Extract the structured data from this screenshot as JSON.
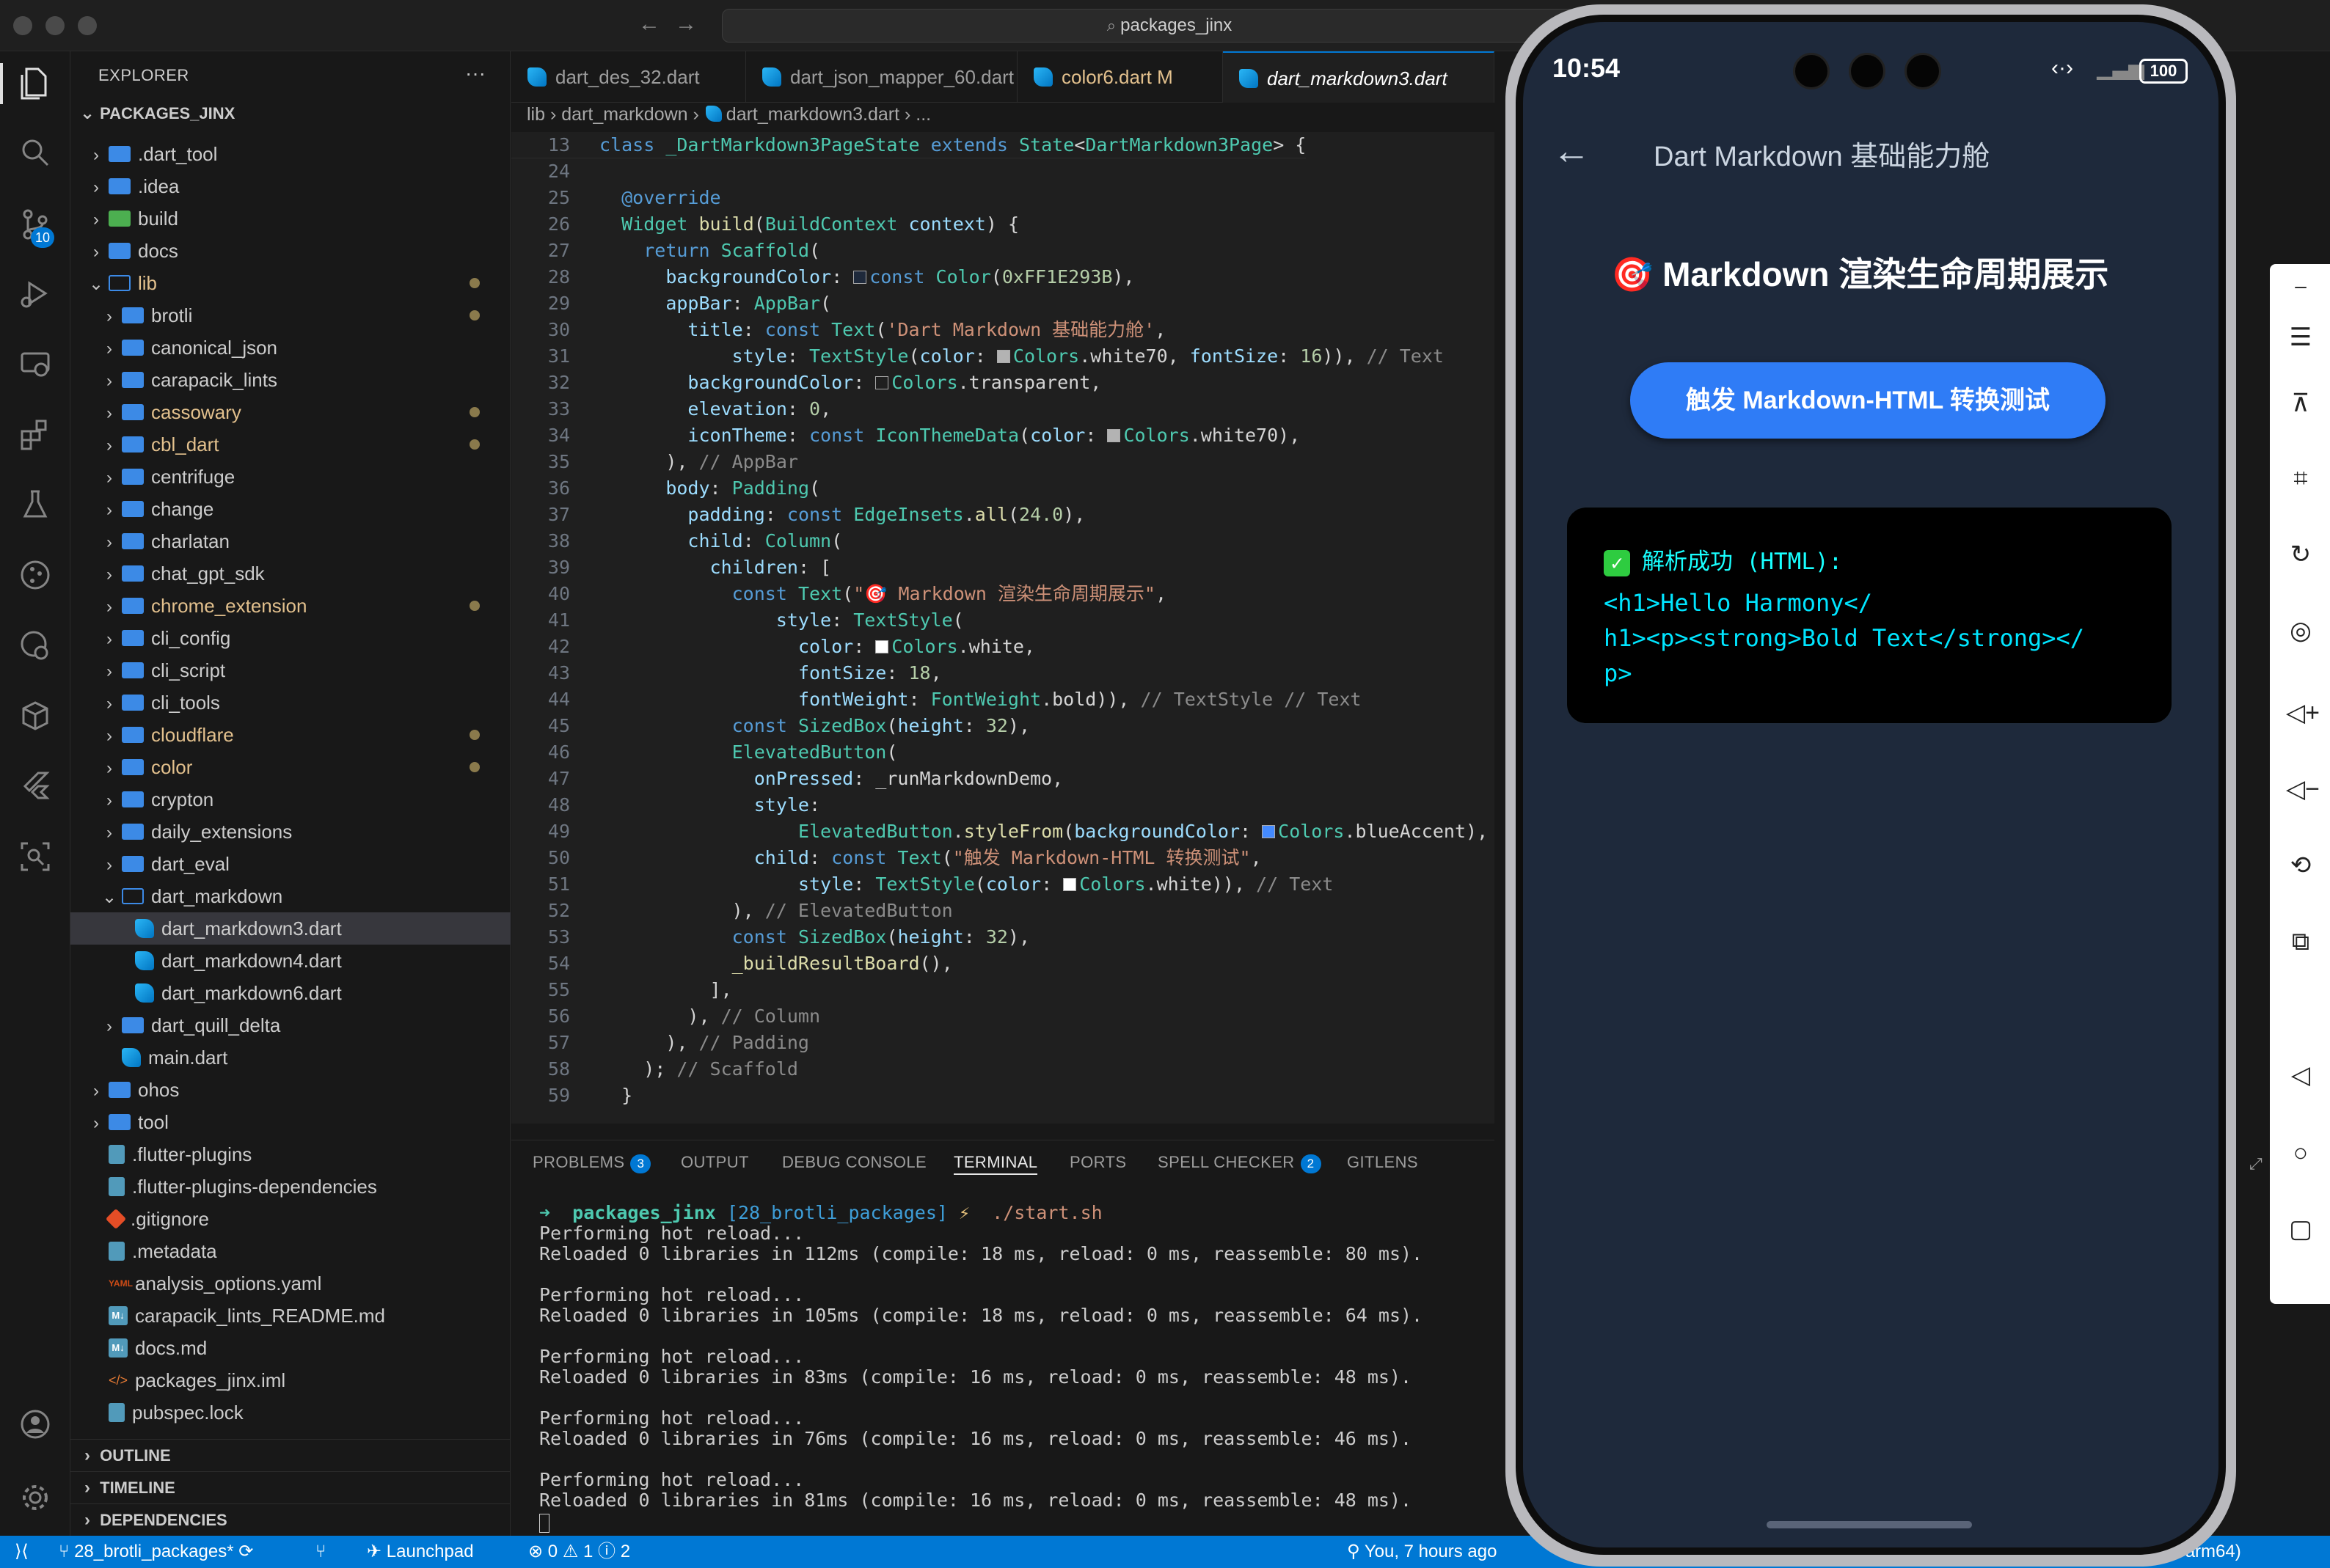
{
  "window": {
    "search": "packages_jinx"
  },
  "activity_bar": {
    "scm_badge": "10"
  },
  "explorer": {
    "title": "EXPLORER",
    "root": "PACKAGES_JINX",
    "items": [
      {
        "label": ".dart_tool",
        "kind": "folder",
        "depth": 1,
        "open": false
      },
      {
        "label": ".idea",
        "kind": "folder",
        "depth": 1,
        "open": false
      },
      {
        "label": "build",
        "kind": "folder-special",
        "depth": 1,
        "open": false
      },
      {
        "label": "docs",
        "kind": "folder",
        "depth": 1,
        "open": false
      },
      {
        "label": "lib",
        "kind": "folder",
        "depth": 1,
        "open": true,
        "color": "yellow",
        "dot": true
      },
      {
        "label": "brotli",
        "kind": "folder",
        "depth": 2,
        "open": false,
        "dot": true
      },
      {
        "label": "canonical_json",
        "kind": "folder",
        "depth": 2,
        "open": false
      },
      {
        "label": "carapacik_lints",
        "kind": "folder",
        "depth": 2,
        "open": false
      },
      {
        "label": "cassowary",
        "kind": "folder",
        "depth": 2,
        "open": false,
        "color": "yellow",
        "dot": true
      },
      {
        "label": "cbl_dart",
        "kind": "folder",
        "depth": 2,
        "open": false,
        "color": "yellow",
        "dot": true
      },
      {
        "label": "centrifuge",
        "kind": "folder",
        "depth": 2,
        "open": false
      },
      {
        "label": "change",
        "kind": "folder",
        "depth": 2,
        "open": false
      },
      {
        "label": "charlatan",
        "kind": "folder",
        "depth": 2,
        "open": false
      },
      {
        "label": "chat_gpt_sdk",
        "kind": "folder",
        "depth": 2,
        "open": false
      },
      {
        "label": "chrome_extension",
        "kind": "folder",
        "depth": 2,
        "open": false,
        "color": "yellow",
        "dot": true
      },
      {
        "label": "cli_config",
        "kind": "folder",
        "depth": 2,
        "open": false
      },
      {
        "label": "cli_script",
        "kind": "folder",
        "depth": 2,
        "open": false
      },
      {
        "label": "cli_tools",
        "kind": "folder",
        "depth": 2,
        "open": false
      },
      {
        "label": "cloudflare",
        "kind": "folder",
        "depth": 2,
        "open": false,
        "color": "yellow",
        "dot": true
      },
      {
        "label": "color",
        "kind": "folder",
        "depth": 2,
        "open": false,
        "color": "yellow",
        "dot": true
      },
      {
        "label": "crypton",
        "kind": "folder",
        "depth": 2,
        "open": false
      },
      {
        "label": "daily_extensions",
        "kind": "folder",
        "depth": 2,
        "open": false
      },
      {
        "label": "dart_eval",
        "kind": "folder",
        "depth": 2,
        "open": false
      },
      {
        "label": "dart_markdown",
        "kind": "folder",
        "depth": 2,
        "open": true
      },
      {
        "label": "dart_markdown3.dart",
        "kind": "dart",
        "depth": 3,
        "selected": true
      },
      {
        "label": "dart_markdown4.dart",
        "kind": "dart",
        "depth": 3
      },
      {
        "label": "dart_markdown6.dart",
        "kind": "dart",
        "depth": 3
      },
      {
        "label": "dart_quill_delta",
        "kind": "folder",
        "depth": 2,
        "open": false
      },
      {
        "label": "main.dart",
        "kind": "dart",
        "depth": 2
      },
      {
        "label": "ohos",
        "kind": "folder",
        "depth": 1,
        "open": false
      },
      {
        "label": "tool",
        "kind": "folder",
        "depth": 1,
        "open": false
      },
      {
        "label": ".flutter-plugins",
        "kind": "doc",
        "depth": 1
      },
      {
        "label": ".flutter-plugins-dependencies",
        "kind": "doc",
        "depth": 1
      },
      {
        "label": ".gitignore",
        "kind": "git",
        "depth": 1
      },
      {
        "label": ".metadata",
        "kind": "doc",
        "depth": 1
      },
      {
        "label": "analysis_options.yaml",
        "kind": "yaml",
        "depth": 1
      },
      {
        "label": "carapacik_lints_README.md",
        "kind": "md",
        "depth": 1
      },
      {
        "label": "docs.md",
        "kind": "md",
        "depth": 1
      },
      {
        "label": "packages_jinx.iml",
        "kind": "xml",
        "depth": 1
      },
      {
        "label": "pubspec.lock",
        "kind": "doc",
        "depth": 1
      }
    ],
    "sections": [
      "OUTLINE",
      "TIMELINE",
      "DEPENDENCIES"
    ]
  },
  "tabs": [
    {
      "label": "dart_des_32.dart",
      "active": false
    },
    {
      "label": "dart_json_mapper_60.dart",
      "active": false
    },
    {
      "label": "color6.dart",
      "suffix": "M",
      "active": false,
      "modified": true
    },
    {
      "label": "dart_markdown3.dart",
      "active": true
    }
  ],
  "breadcrumb": [
    "lib",
    "dart_markdown",
    "dart_markdown3.dart",
    "..."
  ],
  "code_lines": [
    {
      "n": "13",
      "html": "<span class=\"kw\">class</span> <span class=\"ty\">_DartMarkdown3PageState</span> <span class=\"kw\">extends</span> <span class=\"ty\">State</span><span class=\"tx\">&lt;</span><span class=\"ty\">DartMarkdown3Page</span><span class=\"tx\">&gt; {</span>"
    },
    {
      "n": "24",
      "html": ""
    },
    {
      "n": "25",
      "html": "  <span class=\"kw\">@override</span>"
    },
    {
      "n": "26",
      "html": "  <span class=\"ty\">Widget</span> <span class=\"fn\">build</span><span class=\"tx\">(</span><span class=\"ty\">BuildContext</span> <span class=\"pm\">context</span><span class=\"tx\">) {</span>"
    },
    {
      "n": "27",
      "html": "    <span class=\"kw\">return</span> <span class=\"ty\">Scaffold</span><span class=\"tx\">(</span>"
    },
    {
      "n": "28",
      "html": "      <span class=\"pm\">backgroundColor</span><span class=\"tx\">: </span><span class=\"sw\" style=\"background:#1E293B\"></span><span class=\"kw\">const</span> <span class=\"ty\">Color</span><span class=\"tx\">(</span><span class=\"nu\">0xFF1E293B</span><span class=\"tx\">),</span>"
    },
    {
      "n": "29",
      "html": "      <span class=\"pm\">appBar</span><span class=\"tx\">: </span><span class=\"ty\">AppBar</span><span class=\"tx\">(</span>"
    },
    {
      "n": "30",
      "html": "        <span class=\"pm\">title</span><span class=\"tx\">: </span><span class=\"kw\">const</span> <span class=\"ty\">Text</span><span class=\"tx\">(</span><span class=\"st\">'Dart Markdown 基础能力舱'</span><span class=\"tx\">,</span>"
    },
    {
      "n": "31",
      "html": "            <span class=\"pm\">style</span><span class=\"tx\">: </span><span class=\"ty\">TextStyle</span><span class=\"tx\">(</span><span class=\"pm\">color</span><span class=\"tx\">: </span><span class=\"sw\" style=\"background:#b3b3b3\"></span><span class=\"ty\">Colors</span><span class=\"tx\">.white70, </span><span class=\"pm\">fontSize</span><span class=\"tx\">: </span><span class=\"nu\">16</span><span class=\"tx\">)), </span><span class=\"cmg\">// Text</span>"
    },
    {
      "n": "32",
      "html": "        <span class=\"pm\">backgroundColor</span><span class=\"tx\">: </span><span class=\"sw\" style=\"background:transparent\"></span><span class=\"ty\">Colors</span><span class=\"tx\">.transparent,</span>"
    },
    {
      "n": "33",
      "html": "        <span class=\"pm\">elevation</span><span class=\"tx\">: </span><span class=\"nu\">0</span><span class=\"tx\">,</span>"
    },
    {
      "n": "34",
      "html": "        <span class=\"pm\">iconTheme</span><span class=\"tx\">: </span><span class=\"kw\">const</span> <span class=\"ty\">IconThemeData</span><span class=\"tx\">(</span><span class=\"pm\">color</span><span class=\"tx\">: </span><span class=\"sw\" style=\"background:#b3b3b3\"></span><span class=\"ty\">Colors</span><span class=\"tx\">.white70),</span>"
    },
    {
      "n": "35",
      "html": "      <span class=\"tx\">), </span><span class=\"cmg\">// AppBar</span>"
    },
    {
      "n": "36",
      "html": "      <span class=\"pm\">body</span><span class=\"tx\">: </span><span class=\"ty\">Padding</span><span class=\"tx\">(</span>"
    },
    {
      "n": "37",
      "html": "        <span class=\"pm\">padding</span><span class=\"tx\">: </span><span class=\"kw\">const</span> <span class=\"ty\">EdgeInsets</span><span class=\"tx\">.</span><span class=\"fn\">all</span><span class=\"tx\">(</span><span class=\"nu\">24.0</span><span class=\"tx\">),</span>"
    },
    {
      "n": "38",
      "html": "        <span class=\"pm\">child</span><span class=\"tx\">: </span><span class=\"ty\">Column</span><span class=\"tx\">(</span>"
    },
    {
      "n": "39",
      "html": "          <span class=\"pm\">children</span><span class=\"tx\">: [</span>"
    },
    {
      "n": "40",
      "html": "            <span class=\"kw\">const</span> <span class=\"ty\">Text</span><span class=\"tx\">(</span><span class=\"st\">\"🎯 Markdown 渲染生命周期展示\"</span><span class=\"tx\">,</span>"
    },
    {
      "n": "41",
      "html": "                <span class=\"pm\">style</span><span class=\"tx\">: </span><span class=\"ty\">TextStyle</span><span class=\"tx\">(</span>"
    },
    {
      "n": "42",
      "html": "                  <span class=\"pm\">color</span><span class=\"tx\">: </span><span class=\"sw\" style=\"background:#ffffff\"></span><span class=\"ty\">Colors</span><span class=\"tx\">.white,</span>"
    },
    {
      "n": "43",
      "html": "                  <span class=\"pm\">fontSize</span><span class=\"tx\">: </span><span class=\"nu\">18</span><span class=\"tx\">,</span>"
    },
    {
      "n": "44",
      "html": "                  <span class=\"pm\">fontWeight</span><span class=\"tx\">: </span><span class=\"ty\">FontWeight</span><span class=\"tx\">.bold)), </span><span class=\"cmg\">// TextStyle // Text</span>"
    },
    {
      "n": "45",
      "html": "            <span class=\"kw\">const</span> <span class=\"ty\">SizedBox</span><span class=\"tx\">(</span><span class=\"pm\">height</span><span class=\"tx\">: </span><span class=\"nu\">32</span><span class=\"tx\">),</span>"
    },
    {
      "n": "46",
      "html": "            <span class=\"ty\">ElevatedButton</span><span class=\"tx\">(</span>"
    },
    {
      "n": "47",
      "html": "              <span class=\"pm\">onPressed</span><span class=\"tx\">: _runMarkdownDemo,</span>"
    },
    {
      "n": "48",
      "html": "              <span class=\"pm\">style</span><span class=\"tx\">:</span>"
    },
    {
      "n": "49",
      "html": "                  <span class=\"ty\">ElevatedButton</span><span class=\"tx\">.</span><span class=\"fn\">styleFrom</span><span class=\"tx\">(</span><span class=\"pm\">backgroundColor</span><span class=\"tx\">: </span><span class=\"sw\" style=\"background:#448aff\"></span><span class=\"ty\">Colors</span><span class=\"tx\">.blueAccent),</span>"
    },
    {
      "n": "50",
      "html": "              <span class=\"pm\">child</span><span class=\"tx\">: </span><span class=\"kw\">const</span> <span class=\"ty\">Text</span><span class=\"tx\">(</span><span class=\"st\">\"触发 Markdown-HTML 转换测试\"</span><span class=\"tx\">,</span>"
    },
    {
      "n": "51",
      "html": "                  <span class=\"pm\">style</span><span class=\"tx\">: </span><span class=\"ty\">TextStyle</span><span class=\"tx\">(</span><span class=\"pm\">color</span><span class=\"tx\">: </span><span class=\"sw\" style=\"background:#ffffff\"></span><span class=\"ty\">Colors</span><span class=\"tx\">.white)), </span><span class=\"cmg\">// Text</span>"
    },
    {
      "n": "52",
      "html": "            <span class=\"tx\">), </span><span class=\"cmg\">// ElevatedButton</span>"
    },
    {
      "n": "53",
      "html": "            <span class=\"kw\">const</span> <span class=\"ty\">SizedBox</span><span class=\"tx\">(</span><span class=\"pm\">height</span><span class=\"tx\">: </span><span class=\"nu\">32</span><span class=\"tx\">),</span>"
    },
    {
      "n": "54",
      "html": "            <span class=\"fn\">_buildResultBoard</span><span class=\"tx\">(),</span>"
    },
    {
      "n": "55",
      "html": "          <span class=\"tx\">],</span>"
    },
    {
      "n": "56",
      "html": "        <span class=\"tx\">), </span><span class=\"cmg\">// Column</span>"
    },
    {
      "n": "57",
      "html": "      <span class=\"tx\">), </span><span class=\"cmg\">// Padding</span>"
    },
    {
      "n": "58",
      "html": "    <span class=\"tx\">); </span><span class=\"cmg\">// Scaffold</span>"
    },
    {
      "n": "59",
      "html": "  <span class=\"tx\">}</span>"
    }
  ],
  "panel": {
    "tabs": [
      {
        "label": "PROBLEMS",
        "badge": "3"
      },
      {
        "label": "OUTPUT"
      },
      {
        "label": "DEBUG CONSOLE"
      },
      {
        "label": "TERMINAL",
        "active": true
      },
      {
        "label": "PORTS"
      },
      {
        "label": "SPELL CHECKER",
        "badge": "2"
      },
      {
        "label": "GITLENS"
      }
    ],
    "prompt": {
      "dir": "packages_jinx",
      "branch": "[28_brotli_packages]",
      "symbol": "⚡",
      "cmd": "./start.sh"
    },
    "lines": [
      "Performing hot reload...",
      "Reloaded 0 libraries in 112ms (compile: 18 ms, reload: 0 ms, reassemble: 80 ms).",
      "",
      "Performing hot reload...",
      "Reloaded 0 libraries in 105ms (compile: 18 ms, reload: 0 ms, reassemble: 64 ms).",
      "",
      "Performing hot reload...",
      "Reloaded 0 libraries in 83ms (compile: 16 ms, reload: 0 ms, reassemble: 48 ms).",
      "",
      "Performing hot reload...",
      "Reloaded 0 libraries in 76ms (compile: 16 ms, reload: 0 ms, reassemble: 46 ms).",
      "",
      "Performing hot reload...",
      "Reloaded 0 libraries in 81ms (compile: 16 ms, reload: 0 ms, reassemble: 48 ms)."
    ]
  },
  "status_bar": {
    "branch": "28_brotli_packages*",
    "launchpad": "Launchpad",
    "errors": "0",
    "warnings": "1",
    "info": "2",
    "blame": "You, 7 hours ago",
    "platform": "hos-arm64)"
  },
  "phone": {
    "time": "10:54",
    "battery": "100",
    "app_title": "Dart Markdown 基础能力舱",
    "heading_emoji": "🎯",
    "heading": "Markdown 渲染生命周期展示",
    "button": "触发 Markdown-HTML 转换测试",
    "result_label": "解析成功 (HTML):",
    "result_lines": [
      "<h1>Hello Harmony</",
      "h1><p><strong>Bold Text</strong></",
      "p>"
    ]
  },
  "colors": {
    "accent": "#0078d4",
    "phone_bg": "#1E293B",
    "button": "#2f7cf6",
    "result_text": "#00e5ff",
    "result_label": "#18ffff"
  }
}
